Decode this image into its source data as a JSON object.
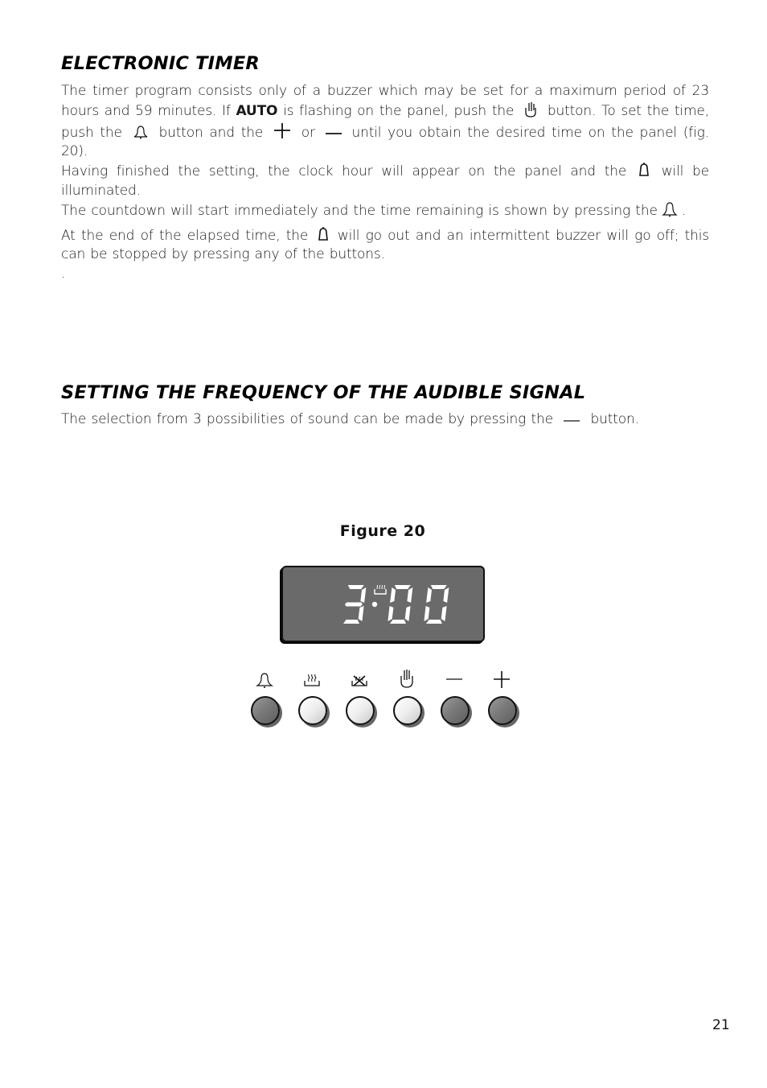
{
  "sections": [
    {
      "title": "ELECTRONIC TIMER",
      "paragraphs": {
        "p1_a": "The timer program consists only of a buzzer which may be set for a maximum period of 23 hours and 59 minutes. If ",
        "p1_bold": "AUTO",
        "p1_b": " is flashing on the panel, push the",
        "p1_c": "button.",
        "p2_a": "To set the time, push the",
        "p2_b": "button and the",
        "p2_c": "or",
        "p2_d": "until you obtain the desired time on the panel (fig. 20).",
        "p3_a": "Having finished the setting, the clock hour will appear on the panel and the",
        "p3_b": "will be illuminated.",
        "p4_a": "The countdown will start immediately and the time remaining is shown by pressing the",
        "p4_b": ".",
        "p5_a": "At the end of the elapsed time, the",
        "p5_b": "will go out and an intermittent buzzer will go off; this can be stopped by pressing any of the buttons.",
        "p6": "."
      },
      "inline_icons": [
        "manual-hand-icon",
        "bell-icon",
        "plus-icon",
        "minus-icon",
        "bell-filled-icon",
        "bell-icon",
        "bell-filled-icon"
      ]
    },
    {
      "title": "SETTING THE FREQUENCY OF THE AUDIBLE SIGNAL",
      "paragraphs": {
        "p1_a": "The selection from 3 possibilities of sound can be made by pressing the",
        "p1_b": "button."
      },
      "inline_icons": [
        "minus-icon"
      ]
    }
  ],
  "figure": {
    "caption": "Figure 20",
    "display": {
      "time": "3:00",
      "digits": [
        "3",
        "0",
        "0"
      ],
      "indicator_icon": "cooking-icon",
      "background": "#6a6a6a",
      "segment_color": "#ffffff"
    },
    "buttons": [
      {
        "icon": "bell-icon",
        "label": "timer",
        "tone": "dark"
      },
      {
        "icon": "cooking-duration-icon",
        "label": "cooking duration",
        "tone": "light"
      },
      {
        "icon": "end-cooking-icon",
        "label": "end of cooking",
        "tone": "light"
      },
      {
        "icon": "manual-hand-icon",
        "label": "manual",
        "tone": "light"
      },
      {
        "icon": "minus-icon",
        "label": "minus",
        "tone": "dark"
      },
      {
        "icon": "plus-icon",
        "label": "plus",
        "tone": "dark"
      }
    ]
  },
  "page_number": "21"
}
